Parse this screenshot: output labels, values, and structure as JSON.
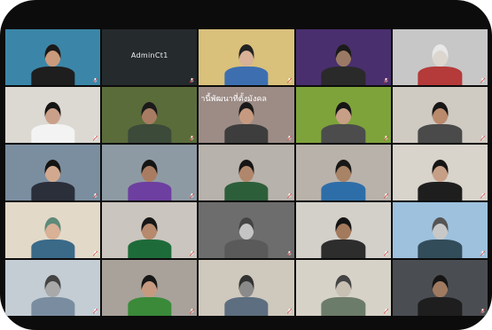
{
  "meeting": {
    "tiles": [
      {
        "name": "",
        "bg": "#3b86a8",
        "skin": "#c99a7c",
        "shirt": "#1e1e1e",
        "hair": "#1a1a1a",
        "speaking": false
      },
      {
        "name": "",
        "bg": "#252a2d",
        "center": "AdminCt1",
        "hidden": true
      },
      {
        "name": "",
        "bg": "#d9c07b",
        "skin": "#d8b196",
        "shirt": "#3d6fb0",
        "hair": "#222222",
        "speaking": false
      },
      {
        "name": "",
        "bg": "#4a2f6e",
        "skin": "#9a7a64",
        "shirt": "#2a2a2a",
        "hair": "#1b1b1b",
        "speaking": false
      },
      {
        "name": "",
        "bg": "#c7c7c7",
        "skin": "#dcd6cf",
        "shirt": "#b53a3a",
        "hair": "#e8e8e8",
        "speaking": false
      },
      {
        "name": "",
        "bg": "#dcd8d2",
        "skin": "#caa08a",
        "shirt": "#f3f3f3",
        "hair": "#151515",
        "speaking": false
      },
      {
        "name": "",
        "bg": "#5b6c3b",
        "skin": "#a77c62",
        "shirt": "#3c4a3a",
        "hair": "#1a1a1a",
        "speaking": false
      },
      {
        "name": "",
        "bg": "#9d8c86",
        "banner": "านี้พัฒนาที่ตั้งมังคล",
        "skin": "#c69a80",
        "shirt": "#3d3d3d",
        "hair": "#1a1a1a",
        "speaking": false
      },
      {
        "name": "",
        "bg": "#7ea33a",
        "skin": "#c79f86",
        "shirt": "#4c4c4c",
        "hair": "#151515",
        "speaking": false
      },
      {
        "name": "",
        "bg": "#cfcac2",
        "skin": "#b98a6c",
        "shirt": "#4a4a4a",
        "hair": "#161616",
        "speaking": false
      },
      {
        "name": "",
        "bg": "#7b8ea0",
        "skin": "#d2a98e",
        "shirt": "#2b2f3a",
        "hair": "#141414",
        "speaking": false
      },
      {
        "name": "",
        "bg": "#8e9aa3",
        "skin": "#a97c62",
        "shirt": "#6d3fa0",
        "hair": "#151515",
        "speaking": false
      },
      {
        "name": "",
        "bg": "#b7b2ab",
        "skin": "#b0876c",
        "shirt": "#2d5e3a",
        "hair": "#151515",
        "speaking": false
      },
      {
        "name": "",
        "bg": "#b8b2aa",
        "skin": "#a98366",
        "shirt": "#2e6ea8",
        "hair": "#171717",
        "speaking": false
      },
      {
        "name": "",
        "bg": "#d8d3cb",
        "skin": "#c79f86",
        "shirt": "#1e1e1e",
        "hair": "#151515",
        "speaking": false
      },
      {
        "name": "",
        "bg": "#e3d9c8",
        "skin": "#d8b196",
        "shirt": "#3a6a88",
        "hair": "#5d8a7a",
        "speaking": false
      },
      {
        "name": "",
        "bg": "#cac5be",
        "skin": "#b7896d",
        "shirt": "#1e6b3a",
        "hair": "#171717",
        "speaking": false
      },
      {
        "name": "",
        "bg": "#6d6d6d",
        "skin": "#c4c4c4",
        "shirt": "#5a5a5a",
        "hair": "#444444",
        "speaking": false
      },
      {
        "name": "",
        "bg": "#d2d0c9",
        "skin": "#a37a5c",
        "shirt": "#2d2d2d",
        "hair": "#151515",
        "speaking": false
      },
      {
        "name": "",
        "bg": "#9ec1dd",
        "skin": "#c8c8c8",
        "shirt": "#334c5a",
        "hair": "#555555",
        "speaking": true
      },
      {
        "name": "",
        "bg": "#c4cdd4",
        "skin": "#a9a9a9",
        "shirt": "#7a8da0",
        "hair": "#444444",
        "speaking": false
      },
      {
        "name": "",
        "bg": "#a8a29a",
        "skin": "#c69a80",
        "shirt": "#3a8a3a",
        "hair": "#171717",
        "speaking": false
      },
      {
        "name": "",
        "bg": "#cfc8bd",
        "skin": "#8a8a8a",
        "shirt": "#5c6e80",
        "hair": "#333333",
        "speaking": false
      },
      {
        "name": "",
        "bg": "#d6d2c8",
        "skin": "#c9c0b4",
        "shirt": "#6c7c6a",
        "hair": "#444444",
        "speaking": false
      },
      {
        "name": "",
        "bg": "#4a4d52",
        "skin": "#a07a60",
        "shirt": "#1e1e1e",
        "hair": "#151515",
        "speaking": false
      }
    ]
  }
}
